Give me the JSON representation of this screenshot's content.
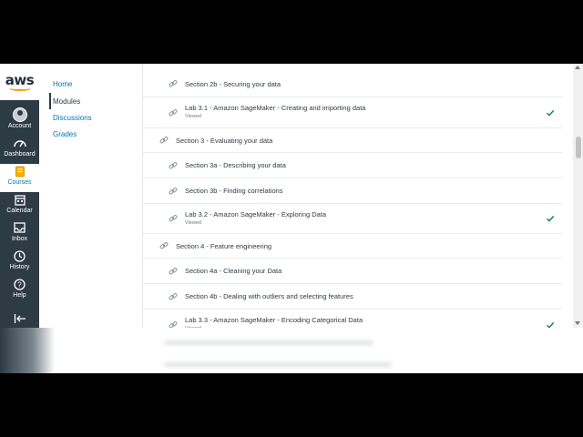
{
  "global_nav": {
    "logo_text": "aws",
    "items": [
      {
        "label": "Account",
        "icon": "user-avatar-icon"
      },
      {
        "label": "Dashboard",
        "icon": "dashboard-icon"
      },
      {
        "label": "Courses",
        "icon": "courses-book-icon",
        "active": true
      },
      {
        "label": "Calendar",
        "icon": "calendar-icon"
      },
      {
        "label": "Inbox",
        "icon": "inbox-icon"
      },
      {
        "label": "History",
        "icon": "history-clock-icon"
      },
      {
        "label": "Help",
        "icon": "help-icon"
      }
    ],
    "collapse_icon": "collapse-arrow-icon"
  },
  "course_nav": {
    "items": [
      {
        "label": "Home"
      },
      {
        "label": "Modules",
        "active": true
      },
      {
        "label": "Discussions"
      },
      {
        "label": "Grades"
      }
    ]
  },
  "modules": {
    "rows": [
      {
        "title": "Section 2b - Securing your data",
        "sub": "",
        "indent": 1,
        "checked": false
      },
      {
        "title": "Lab 3.1 - Amazon SageMaker - Creating and importing data",
        "sub": "Viewed",
        "indent": 1,
        "checked": true
      },
      {
        "title": "Section 3 - Evaluating your data",
        "sub": "",
        "indent": 0,
        "checked": false
      },
      {
        "title": "Section 3a - Describing your data",
        "sub": "",
        "indent": 1,
        "checked": false
      },
      {
        "title": "Section 3b - Finding correlations",
        "sub": "",
        "indent": 1,
        "checked": false
      },
      {
        "title": "Lab 3.2 - Amazon SageMaker - Exploring Data",
        "sub": "Viewed",
        "indent": 1,
        "checked": true
      },
      {
        "title": "Section 4 - Feature engineering",
        "sub": "",
        "indent": 0,
        "checked": false
      },
      {
        "title": "Section 4a - Cleaning your Data",
        "sub": "",
        "indent": 1,
        "checked": false
      },
      {
        "title": "Section 4b - Dealing with outliers and selecting features",
        "sub": "",
        "indent": 1,
        "checked": false
      },
      {
        "title": "Lab 3.3 - Amazon SageMaker - Encoding Categorical Data",
        "sub": "Viewed",
        "indent": 1,
        "checked": true
      }
    ]
  },
  "colors": {
    "nav_bg": "#2d3b45",
    "link_blue": "#0374b5",
    "check_green": "#0b874b",
    "aws_orange": "#ff9900"
  }
}
